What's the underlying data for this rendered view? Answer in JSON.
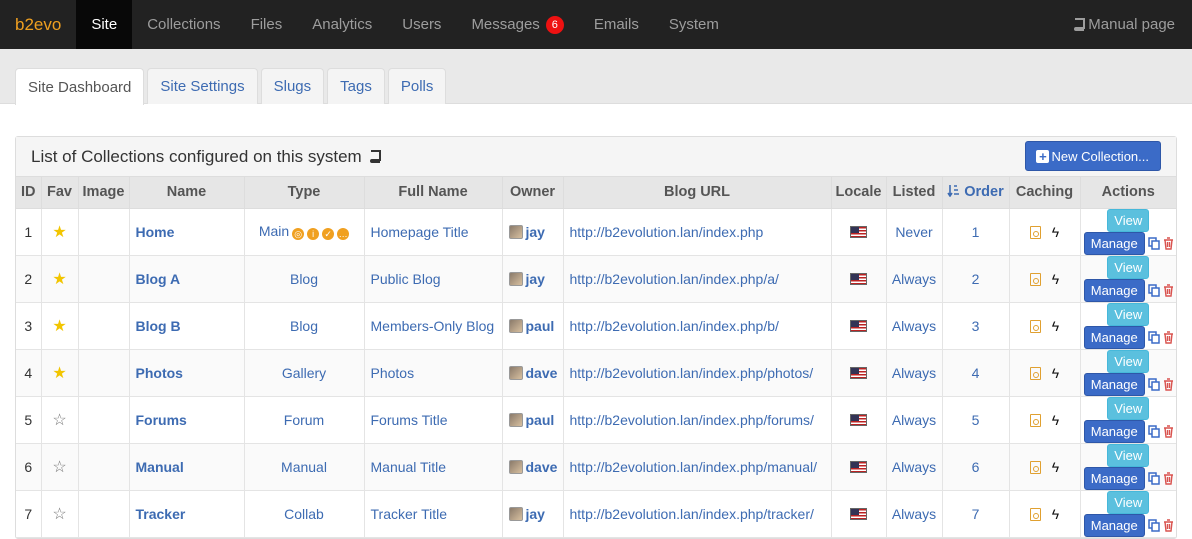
{
  "brand": "b2evo",
  "nav": {
    "items": [
      "Site",
      "Collections",
      "Files",
      "Analytics",
      "Users",
      "Messages",
      "Emails",
      "System"
    ],
    "messages_badge": "6",
    "manual_label": "Manual page"
  },
  "tabs": [
    "Site Dashboard",
    "Site Settings",
    "Slugs",
    "Tags",
    "Polls"
  ],
  "panel": {
    "title": "List of Collections configured on this system",
    "new_button": "New Collection..."
  },
  "table": {
    "headers": [
      "ID",
      "Fav",
      "Image",
      "Name",
      "Type",
      "Full Name",
      "Owner",
      "Blog URL",
      "Locale",
      "Listed",
      "Order",
      "Caching",
      "Actions"
    ],
    "view_label": "View",
    "manage_label": "Manage",
    "rows": [
      {
        "id": "1",
        "fav": true,
        "name": "Home",
        "type": "Main",
        "full_name": "Homepage Title",
        "owner": "jay",
        "url": "http://b2evolution.lan/index.php",
        "listed": "Never",
        "order": "1"
      },
      {
        "id": "2",
        "fav": true,
        "name": "Blog A",
        "type": "Blog",
        "full_name": "Public Blog",
        "owner": "jay",
        "url": "http://b2evolution.lan/index.php/a/",
        "listed": "Always",
        "order": "2"
      },
      {
        "id": "3",
        "fav": true,
        "name": "Blog B",
        "type": "Blog",
        "full_name": "Members-Only Blog",
        "owner": "paul",
        "url": "http://b2evolution.lan/index.php/b/",
        "listed": "Always",
        "order": "3"
      },
      {
        "id": "4",
        "fav": true,
        "name": "Photos",
        "type": "Gallery",
        "full_name": "Photos",
        "owner": "dave",
        "url": "http://b2evolution.lan/index.php/photos/",
        "listed": "Always",
        "order": "4"
      },
      {
        "id": "5",
        "fav": false,
        "name": "Forums",
        "type": "Forum",
        "full_name": "Forums Title",
        "owner": "paul",
        "url": "http://b2evolution.lan/index.php/forums/",
        "listed": "Always",
        "order": "5"
      },
      {
        "id": "6",
        "fav": false,
        "name": "Manual",
        "type": "Manual",
        "full_name": "Manual Title",
        "owner": "dave",
        "url": "http://b2evolution.lan/index.php/manual/",
        "listed": "Always",
        "order": "6"
      },
      {
        "id": "7",
        "fav": false,
        "name": "Tracker",
        "type": "Collab",
        "full_name": "Tracker Title",
        "owner": "jay",
        "url": "http://b2evolution.lan/index.php/tracker/",
        "listed": "Always",
        "order": "7"
      }
    ]
  }
}
